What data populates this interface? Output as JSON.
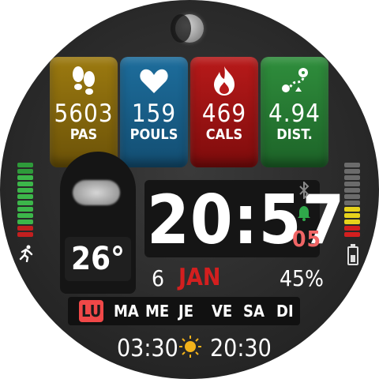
{
  "metrics": {
    "steps": {
      "value": "5603",
      "label": "PAS",
      "icon": "footprints-icon"
    },
    "pulse": {
      "value": "159",
      "label": "POULS",
      "icon": "heart-icon"
    },
    "cals": {
      "value": "469",
      "label": "CALS",
      "icon": "flame-icon"
    },
    "dist": {
      "value": "4.94",
      "label": "DIST.",
      "icon": "route-icon"
    }
  },
  "weather": {
    "temp": "26°",
    "icon": "cloud-icon"
  },
  "time": {
    "hm": "20:57",
    "seconds": "05"
  },
  "date": {
    "day": "6",
    "month": "JAN"
  },
  "battery": {
    "percent": "45%"
  },
  "weekdays": [
    "LU",
    "MA",
    "ME",
    "JE",
    "VE",
    "SA",
    "DI"
  ],
  "weekday_active_index": 0,
  "sun": {
    "sunrise": "03:30",
    "sunset": "20:30",
    "icon": "sun-icon"
  },
  "indicators": {
    "activity_icon": "running-icon",
    "bluetooth_icon": "bluetooth-icon",
    "alarm_icon": "bell-icon",
    "battery_icon": "battery-icon"
  },
  "colors": {
    "steps": "#9c7a10",
    "pulse": "#1d6d9c",
    "cals": "#b81a1a",
    "dist": "#2f8e3c",
    "accent_red": "#f04848",
    "seconds": "#f06565"
  }
}
